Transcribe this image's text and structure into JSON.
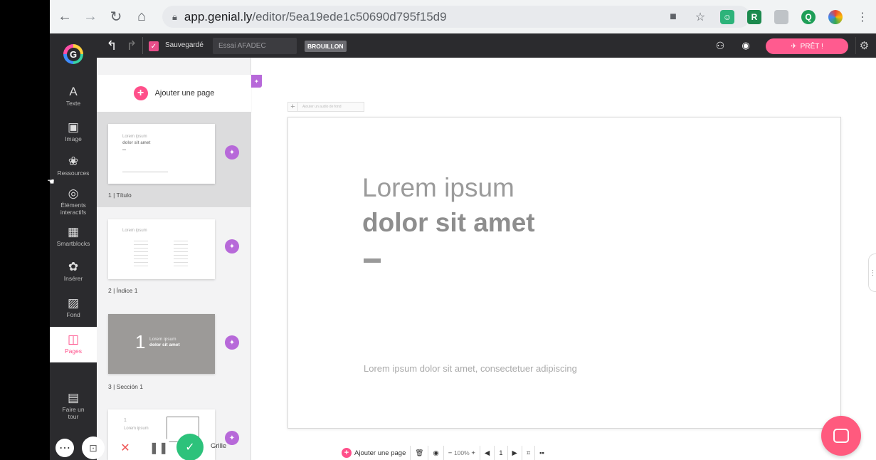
{
  "browser": {
    "url_host": "app.genial.ly",
    "url_path": "/editor/5ea19ede1c50690d795f15d9"
  },
  "toolbar": {
    "saved_label": "Sauvegardé",
    "doc_title": "Essai AFADEC",
    "draft_badge": "BROUILLON",
    "ready_label": "PRÊT !"
  },
  "sidebar": {
    "items": [
      {
        "icon": "A",
        "label": "Texte"
      },
      {
        "icon": "▣",
        "label": "Image"
      },
      {
        "icon": "❀",
        "label": "Ressources"
      },
      {
        "icon": "◎",
        "label": "Éléments interactifs"
      },
      {
        "icon": "▦",
        "label": "Smartblocks"
      },
      {
        "icon": "✿",
        "label": "Insérer"
      },
      {
        "icon": "▨",
        "label": "Fond"
      },
      {
        "icon": "◫",
        "label": "Pages"
      },
      {
        "icon": "▤",
        "label": "Faire un tour"
      }
    ]
  },
  "pages": {
    "add_label": "Ajouter une page",
    "list": [
      {
        "label": "1 | Título",
        "thumb_line1": "Lorem ipsum",
        "thumb_line2": "dolor sit amet"
      },
      {
        "label": "2 | Índice 1",
        "thumb_line1": "Lorem ipsum",
        "thumb_line2": ""
      },
      {
        "label": "3 | Sección 1",
        "thumb_num": "1",
        "thumb_line1": "Lorem ipsum",
        "thumb_line2": "dolor sit amet"
      },
      {
        "label": "",
        "thumb_num": "1",
        "thumb_line1": "Lorem ipsum",
        "thumb_line2": ""
      }
    ]
  },
  "canvas": {
    "audio_hint": "Ajouter un audio de fond",
    "title_line1": "Lorem ipsum",
    "title_line2": "dolor sit amet",
    "subtitle": "Lorem ipsum dolor sit amet, consectetuer adipiscing"
  },
  "bottom_bar": {
    "add_page": "Ajouter une page",
    "zoom": "100%",
    "page_number": "1",
    "grid_label": "Grille"
  },
  "colors": {
    "accent_pink": "#ff4f8a",
    "wand_purple": "#b769d9",
    "toolbar_dark": "#2b2b2e",
    "record_green": "#2dc27b",
    "chat_pink": "#ff5a7e"
  }
}
